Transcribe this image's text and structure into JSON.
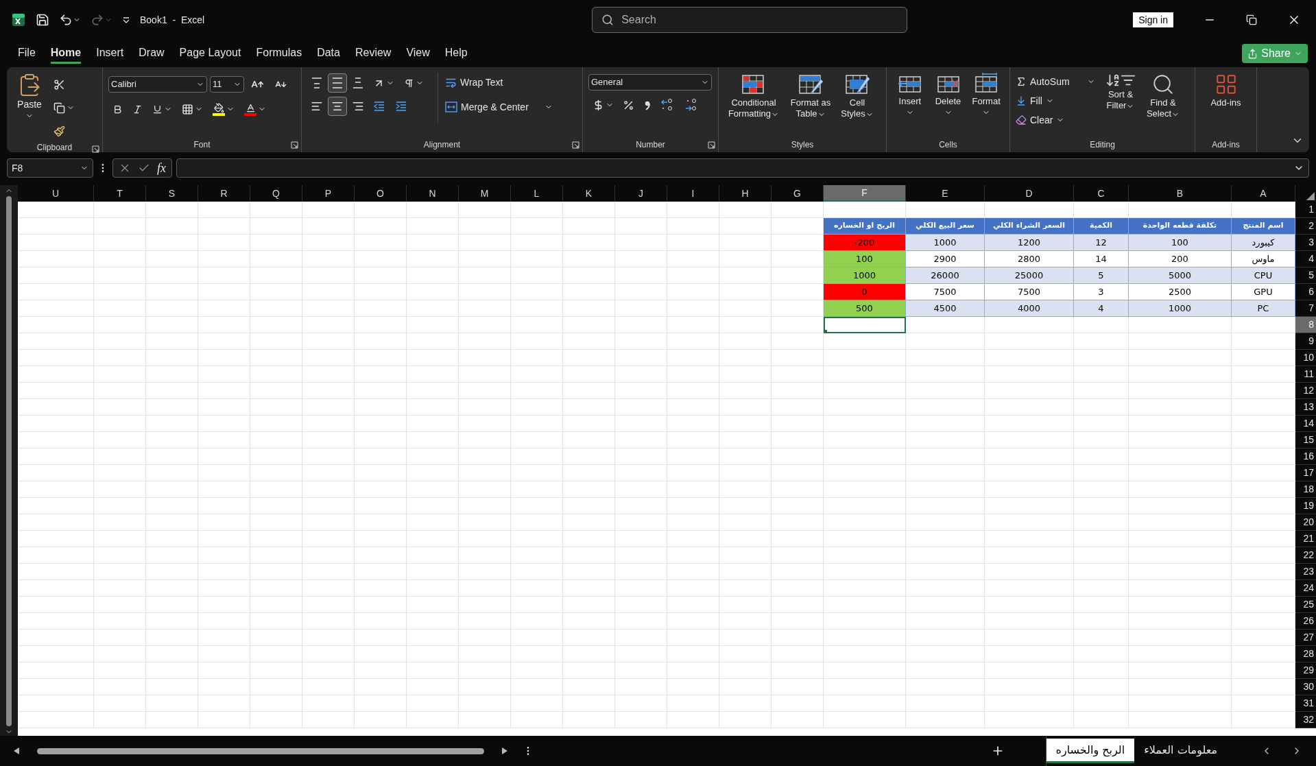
{
  "window": {
    "title": "Book1  -  Excel"
  },
  "search": {
    "placeholder": "Search"
  },
  "account": {
    "sign_in": "Sign in"
  },
  "menu_tabs": [
    {
      "label": "File",
      "selected": false
    },
    {
      "label": "Home",
      "selected": true
    },
    {
      "label": "Insert",
      "selected": false
    },
    {
      "label": "Draw",
      "selected": false
    },
    {
      "label": "Page Layout",
      "selected": false
    },
    {
      "label": "Formulas",
      "selected": false
    },
    {
      "label": "Data",
      "selected": false
    },
    {
      "label": "Review",
      "selected": false
    },
    {
      "label": "View",
      "selected": false
    },
    {
      "label": "Help",
      "selected": false
    }
  ],
  "share": {
    "label": "Share"
  },
  "ribbon": {
    "clipboard": {
      "label": "Clipboard",
      "paste": "Paste"
    },
    "font": {
      "label": "Font",
      "font_name": "Calibri",
      "font_size": "11"
    },
    "alignment": {
      "label": "Alignment",
      "wrap_text": "Wrap Text",
      "merge_center": "Merge & Center",
      "vertical": [
        {
          "selected": false
        },
        {
          "selected": true
        },
        {
          "selected": false
        }
      ],
      "horizontal": [
        {
          "selected": false
        },
        {
          "selected": true
        },
        {
          "selected": false
        }
      ]
    },
    "number": {
      "label": "Number",
      "format": "General"
    },
    "styles": {
      "label": "Styles",
      "buttons": [
        "Conditional Formatting",
        "Format as Table",
        "Cell Styles"
      ]
    },
    "cells": {
      "label": "Cells",
      "buttons": [
        "Insert",
        "Delete",
        "Format"
      ]
    },
    "editing": {
      "label": "Editing",
      "small_buttons": [
        "AutoSum",
        "Fill",
        "Clear"
      ],
      "buttons": [
        "Sort & Filter",
        "Find & Select"
      ]
    },
    "addins": {
      "label": "Add-ins",
      "button": "Add-ins"
    }
  },
  "formula_bar": {
    "name_box": "F8",
    "fx": "fx"
  },
  "sheet": {
    "columns": [
      {
        "label": "U",
        "selected": false
      },
      {
        "label": "T",
        "selected": false
      },
      {
        "label": "S",
        "selected": false
      },
      {
        "label": "R",
        "selected": false
      },
      {
        "label": "Q",
        "selected": false
      },
      {
        "label": "P",
        "selected": false
      },
      {
        "label": "O",
        "selected": false
      },
      {
        "label": "N",
        "selected": false
      },
      {
        "label": "M",
        "selected": false
      },
      {
        "label": "L",
        "selected": false
      },
      {
        "label": "K",
        "selected": false
      },
      {
        "label": "J",
        "selected": false
      },
      {
        "label": "I",
        "selected": false
      },
      {
        "label": "H",
        "selected": false
      },
      {
        "label": "G",
        "selected": false
      },
      {
        "label": "F",
        "selected": true
      },
      {
        "label": "E",
        "selected": false
      },
      {
        "label": "D",
        "selected": false
      },
      {
        "label": "C",
        "selected": false
      },
      {
        "label": "B",
        "selected": false
      },
      {
        "label": "A",
        "selected": false
      }
    ],
    "rows": [
      {
        "label": "1",
        "selected": false
      },
      {
        "label": "2",
        "selected": false
      },
      {
        "label": "3",
        "selected": false
      },
      {
        "label": "4",
        "selected": false
      },
      {
        "label": "5",
        "selected": false
      },
      {
        "label": "6",
        "selected": false
      },
      {
        "label": "7",
        "selected": false
      },
      {
        "label": "8",
        "selected": true
      },
      {
        "label": "9",
        "selected": false
      },
      {
        "label": "10",
        "selected": false
      },
      {
        "label": "11",
        "selected": false
      },
      {
        "label": "12",
        "selected": false
      },
      {
        "label": "13",
        "selected": false
      },
      {
        "label": "14",
        "selected": false
      },
      {
        "label": "15",
        "selected": false
      },
      {
        "label": "16",
        "selected": false
      },
      {
        "label": "17",
        "selected": false
      },
      {
        "label": "18",
        "selected": false
      },
      {
        "label": "19",
        "selected": false
      },
      {
        "label": "20",
        "selected": false
      },
      {
        "label": "21",
        "selected": false
      },
      {
        "label": "22",
        "selected": false
      },
      {
        "label": "23",
        "selected": false
      },
      {
        "label": "24",
        "selected": false
      },
      {
        "label": "25",
        "selected": false
      },
      {
        "label": "26",
        "selected": false
      },
      {
        "label": "27",
        "selected": false
      },
      {
        "label": "28",
        "selected": false
      },
      {
        "label": "29",
        "selected": false
      },
      {
        "label": "30",
        "selected": false
      },
      {
        "label": "31",
        "selected": false
      },
      {
        "label": "32",
        "selected": false
      }
    ],
    "table": {
      "header": [
        "اسم المنتج",
        "تكلفة قطعه الواحدة",
        "الكمية",
        "السعر الشراء الكلي",
        "سعر البيع الكلي",
        "الربح او الخساره"
      ],
      "rows": [
        {
          "product": "كيبورد",
          "unit_cost": "100",
          "quantity": "12",
          "total_purchase": "1200",
          "total_sale": "1000",
          "result": "-200",
          "color": "#ff0000"
        },
        {
          "product": "ماوس",
          "unit_cost": "200",
          "quantity": "14",
          "total_purchase": "2800",
          "total_sale": "2900",
          "result": "100",
          "color": "#92d050"
        },
        {
          "product": "CPU",
          "unit_cost": "5000",
          "quantity": "5",
          "total_purchase": "25000",
          "total_sale": "26000",
          "result": "1000",
          "color": "#92d050"
        },
        {
          "product": "GPU",
          "unit_cost": "2500",
          "quantity": "3",
          "total_purchase": "7500",
          "total_sale": "7500",
          "result": "0",
          "color": "#ff0000"
        },
        {
          "product": "PC",
          "unit_cost": "1000",
          "quantity": "4",
          "total_purchase": "4000",
          "total_sale": "4500",
          "result": "500",
          "color": "#92d050"
        }
      ]
    }
  },
  "sheet_tabs": [
    {
      "label": "معلومات العملاء",
      "selected": false
    },
    {
      "label": "الربح والخساره",
      "selected": true
    }
  ]
}
